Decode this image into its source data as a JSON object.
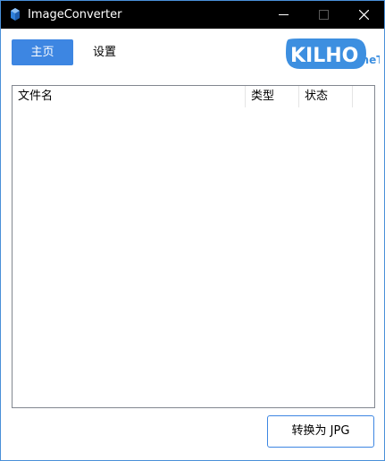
{
  "window": {
    "title": "ImageConverter",
    "icon": "app-icon",
    "controls": [
      "minimize-icon",
      "maximize-icon",
      "close-icon"
    ]
  },
  "tabs": [
    {
      "label": "主页",
      "active": true
    },
    {
      "label": "设置",
      "active": false
    }
  ],
  "logo": {
    "text": "KILHO",
    "suffix": ".neT"
  },
  "file_list": {
    "columns": [
      "文件名",
      "类型",
      "状态"
    ],
    "rows": []
  },
  "actions": {
    "convert_label": "转换为 JPG"
  },
  "colors": {
    "accent": "#3d86e2",
    "titlebar": "#000000",
    "window_border": "#4a90d9"
  }
}
